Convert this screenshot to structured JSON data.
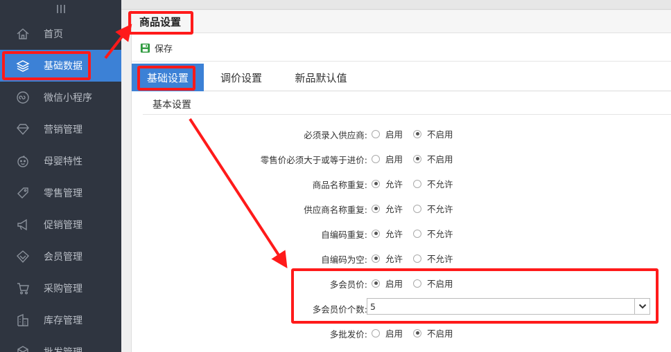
{
  "sidebar": {
    "items": [
      {
        "label": "首页",
        "icon": "home-icon"
      },
      {
        "label": "基础数据",
        "icon": "layers-icon"
      },
      {
        "label": "微信小程序",
        "icon": "miniprogram-icon"
      },
      {
        "label": "营销管理",
        "icon": "diamond-icon"
      },
      {
        "label": "母婴特性",
        "icon": "baby-icon"
      },
      {
        "label": "零售管理",
        "icon": "tag-icon"
      },
      {
        "label": "促销管理",
        "icon": "megaphone-icon"
      },
      {
        "label": "会员管理",
        "icon": "member-icon"
      },
      {
        "label": "采购管理",
        "icon": "cart-icon"
      },
      {
        "label": "库存管理",
        "icon": "warehouse-icon"
      },
      {
        "label": "批发管理",
        "icon": "box-icon"
      }
    ],
    "active_index": 1
  },
  "page": {
    "title": "商品设置",
    "save_label": "保存"
  },
  "tabs": [
    {
      "label": "基础设置",
      "active": true
    },
    {
      "label": "调价设置",
      "active": false
    },
    {
      "label": "新品默认值",
      "active": false
    }
  ],
  "section": {
    "title": "基本设置"
  },
  "form": {
    "rows": [
      {
        "label": "必须录入供应商:",
        "options": [
          "启用",
          "不启用"
        ],
        "selected": 1
      },
      {
        "label": "零售价必须大于或等于进价:",
        "options": [
          "启用",
          "不启用"
        ],
        "selected": 1
      },
      {
        "label": "商品名称重复:",
        "options": [
          "允许",
          "不允许"
        ],
        "selected": 0
      },
      {
        "label": "供应商名称重复:",
        "options": [
          "允许",
          "不允许"
        ],
        "selected": 0
      },
      {
        "label": "自编码重复:",
        "options": [
          "允许",
          "不允许"
        ],
        "selected": 0
      },
      {
        "label": "自编码为空:",
        "options": [
          "允许",
          "不允许"
        ],
        "selected": 0
      },
      {
        "label": "多会员价:",
        "options": [
          "启用",
          "不启用"
        ],
        "selected": 0
      },
      {
        "label": "多会员价个数:",
        "select_value": "5"
      },
      {
        "label": "多批发价:",
        "options": [
          "启用",
          "不启用"
        ],
        "selected": 1
      }
    ]
  },
  "colors": {
    "sidebar_bg": "#2f3540",
    "accent": "#3c81d6",
    "annotation_red": "#ff1a1a",
    "save_icon_green": "#2e9a3e"
  }
}
